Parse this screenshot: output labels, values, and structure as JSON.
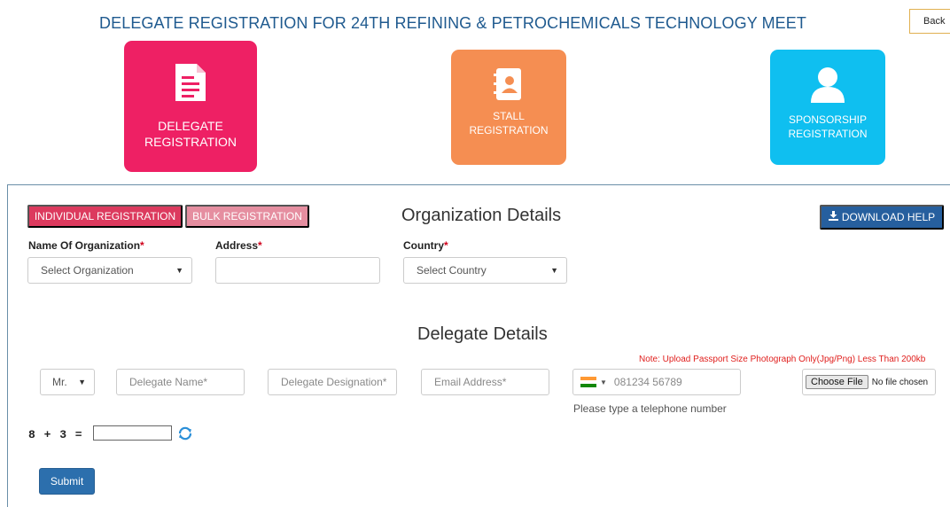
{
  "header": {
    "title": "DELEGATE REGISTRATION FOR 24TH REFINING & PETROCHEMICALS TECHNOLOGY MEET",
    "back_label": "Back"
  },
  "tiles": {
    "delegate": {
      "line1": "DELEGATE",
      "line2": "REGISTRATION",
      "icon": "document-icon",
      "color": "#ee2064"
    },
    "stall": {
      "line1": "STALL",
      "line2": "REGISTRATION",
      "icon": "contact-book-icon",
      "color": "#f58e52"
    },
    "sponsorship": {
      "line1": "SPONSORSHIP",
      "line2": "REGISTRATION",
      "icon": "user-icon",
      "color": "#0fbff0"
    }
  },
  "tabs": {
    "individual_label": "INDIVIDUAL REGISTRATION",
    "bulk_label": "BULK REGISTRATION"
  },
  "download_help_label": "DOWNLOAD HELP",
  "organization": {
    "title": "Organization Details",
    "name_label": "Name Of Organization",
    "name_select": "Select Organization",
    "address_label": "Address",
    "address_value": "",
    "country_label": "Country",
    "country_select": "Select Country",
    "required_mark": "*"
  },
  "delegate": {
    "title": "Delegate Details",
    "salutation": "Mr.",
    "name_placeholder": "Delegate Name*",
    "designation_placeholder": "Delegate Designation*",
    "email_placeholder": "Email Address*",
    "phone_placeholder": "081234 56789",
    "phone_hint": "Please type a telephone number",
    "photo_note": "Note: Upload Passport Size Photograph Only(Jpg/Png) Less Than 200kb",
    "file_button": "Choose File",
    "file_status": "No file chosen"
  },
  "captcha": {
    "question": "8 + 3 =",
    "answer": ""
  },
  "submit_label": "Submit",
  "colors": {
    "title_blue": "#1f5a8f",
    "individual_tab": "#dc3a5e",
    "bulk_tab": "#e58ea0",
    "download_btn": "#265f9e",
    "submit_btn": "#2c6fad",
    "note_red": "#e0201e"
  }
}
